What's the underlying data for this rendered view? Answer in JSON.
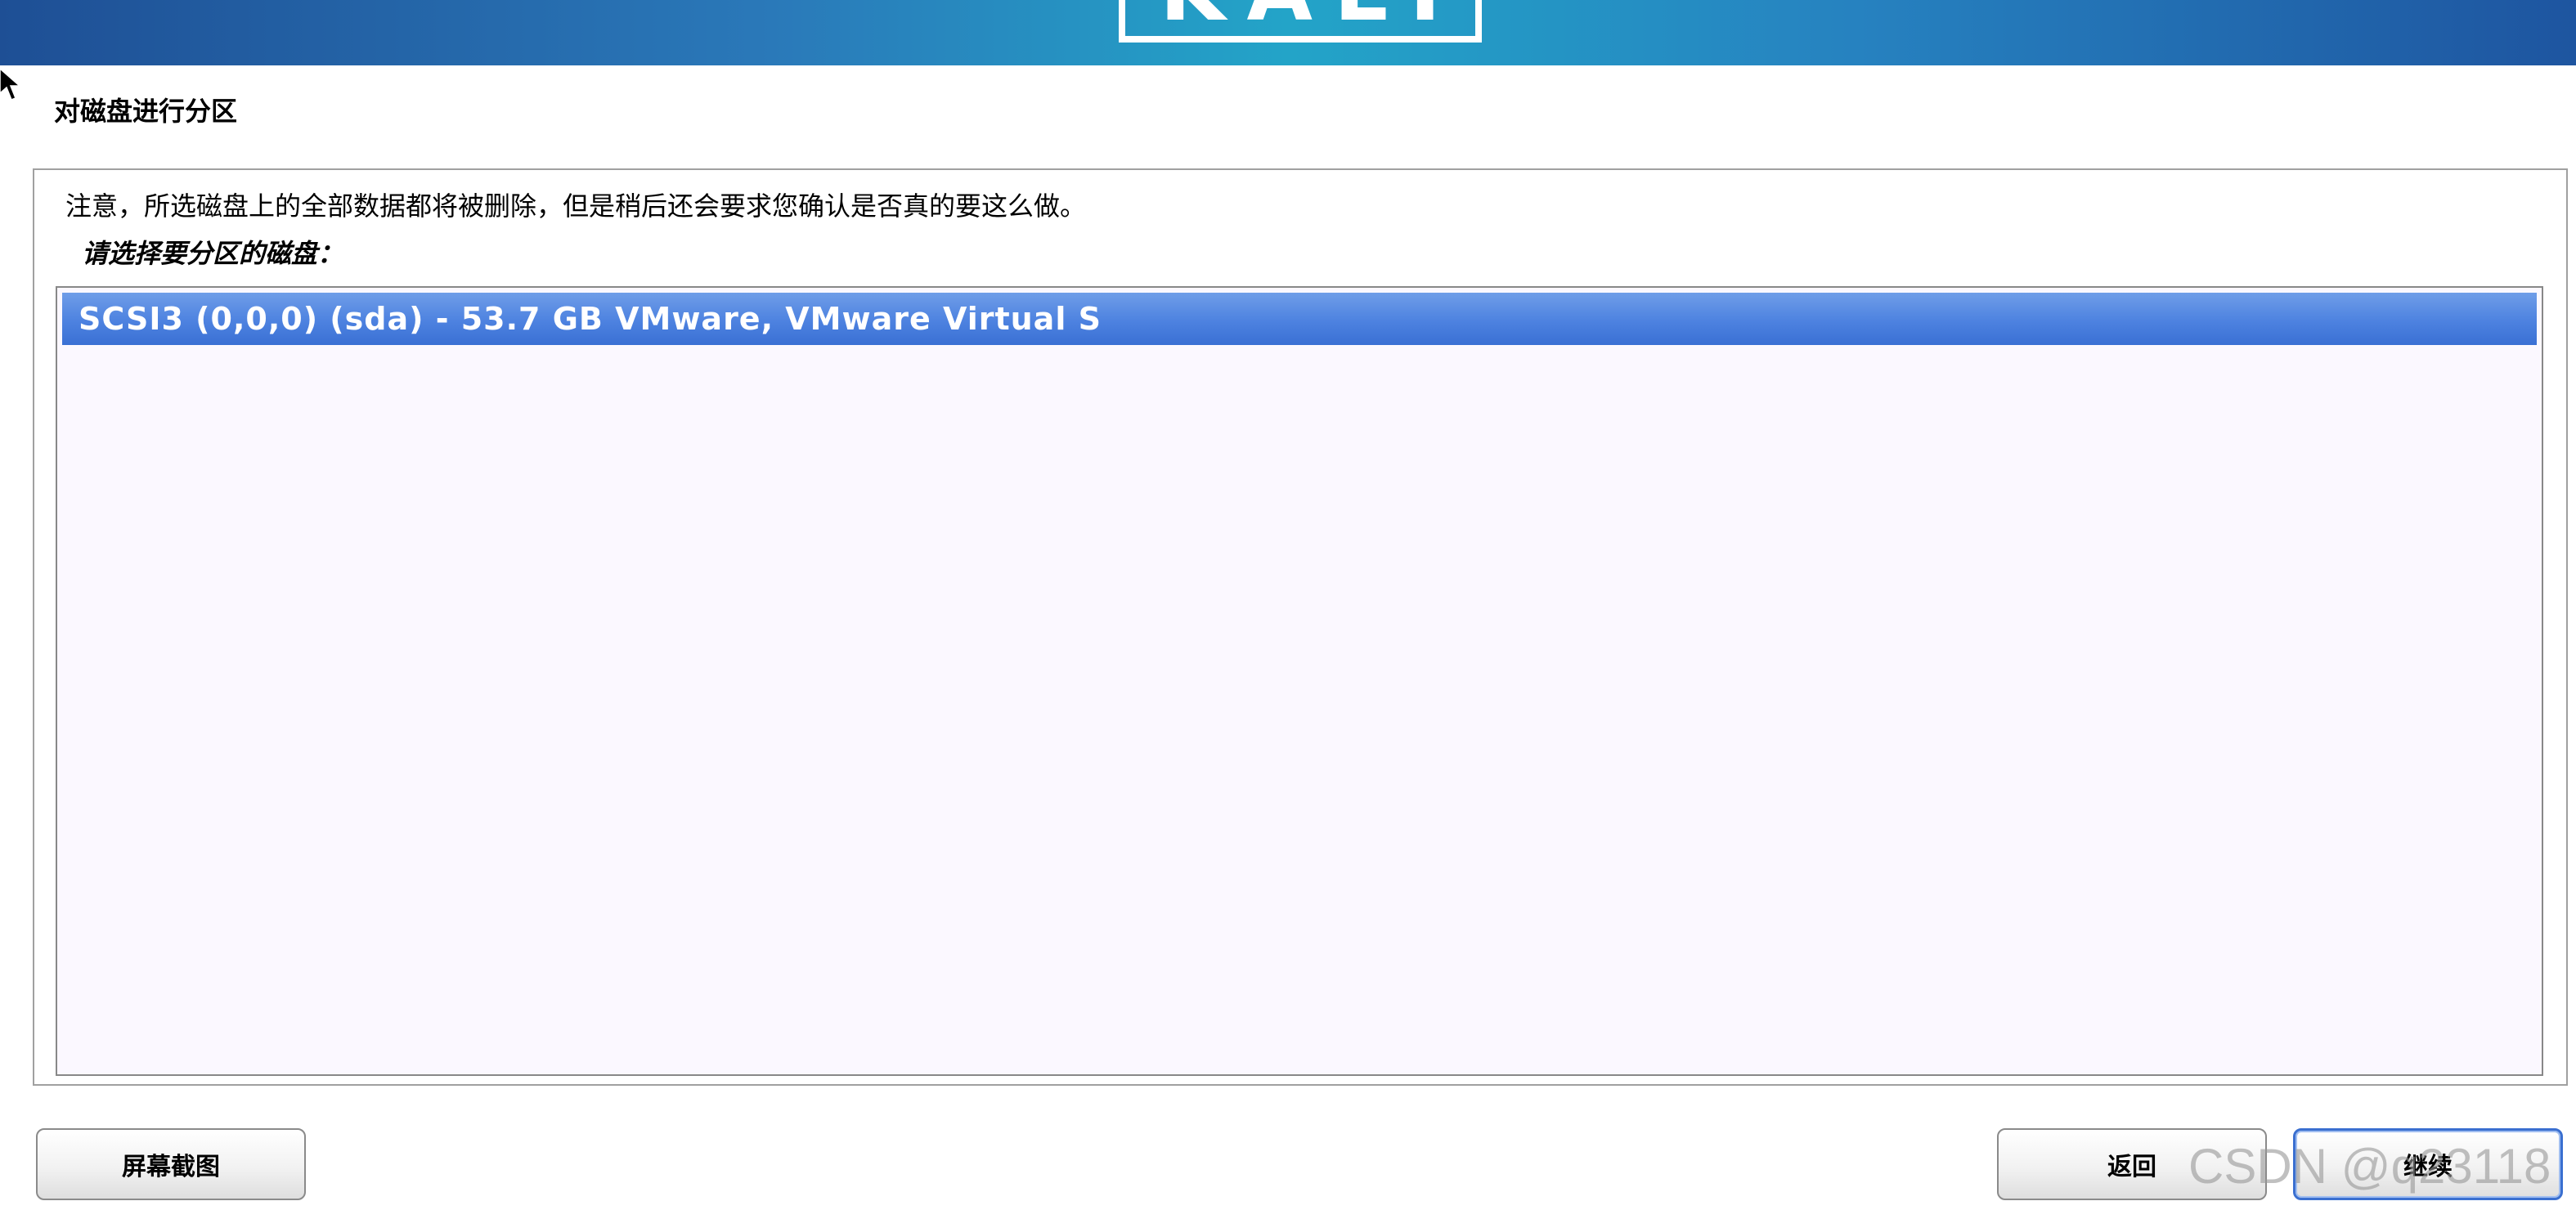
{
  "banner": {
    "logo_text": "KALI"
  },
  "colors": {
    "banner_gradient": [
      "#1e4f95",
      "#23a4c8",
      "#1e55a0"
    ],
    "selection": "#4d82e0",
    "list_background": "#fbf8ff"
  },
  "icons": {
    "cursor": "mouse-pointer-arrow"
  },
  "page": {
    "title": "对磁盘进行分区",
    "notice": "注意，所选磁盘上的全部数据都将被删除，但是稍后还会要求您确认是否真的要这么做。",
    "prompt": "请选择要分区的磁盘："
  },
  "disks": [
    {
      "label": "SCSI3 (0,0,0) (sda) - 53.7 GB VMware, VMware Virtual S",
      "selected": true
    }
  ],
  "buttons": {
    "screenshot": "屏幕截图",
    "back": "返回",
    "continue": "继续"
  },
  "watermark": "CSDN @q23118"
}
